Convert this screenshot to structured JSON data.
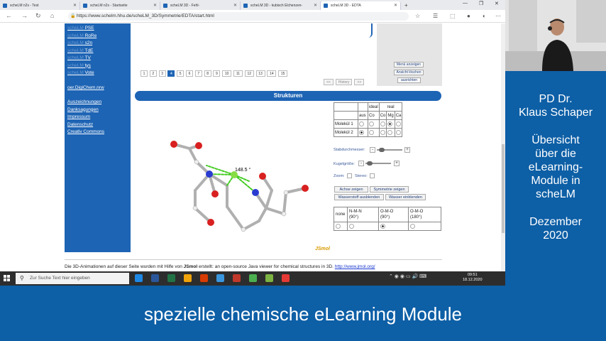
{
  "browser": {
    "tabs": [
      {
        "label": "scheLM n2s - Test",
        "active": false
      },
      {
        "label": "scheLM n2s - Startseite",
        "active": false
      },
      {
        "label": "scheLM 3D - Fehl-",
        "active": false
      },
      {
        "label": "scheLM 3D - kubisch Elchenzen-",
        "active": false
      },
      {
        "label": "scheLM 3D - EDTA",
        "active": true
      }
    ],
    "new_tab": "+",
    "url": "https://www.schelm.hhu.de/scheLM_3D/Symmetrie/EDTA/start.html"
  },
  "sidebar": {
    "links": [
      {
        "prefix": "scheLM",
        "label": "PSE"
      },
      {
        "prefix": "scheLM",
        "label": "RoRe"
      },
      {
        "prefix": "scheLM",
        "label": "s2n"
      },
      {
        "prefix": "scheLM",
        "label": "TdE"
      },
      {
        "prefix": "scheLM",
        "label": "TV"
      },
      {
        "prefix": "scheLM",
        "label": "tys"
      },
      {
        "prefix": "scheLM",
        "label": "Vote"
      }
    ],
    "digichem": "oer.DigiChem.nrw",
    "footer_links": [
      "Auszeichnungen",
      "Danksagungen",
      "Impressum",
      "Datenschutz",
      "Creativ Commons"
    ]
  },
  "pagination": {
    "pages": [
      "1",
      "2",
      "3",
      "4",
      "5",
      "6",
      "7",
      "8",
      "9",
      "10",
      "11",
      "12",
      "13",
      "14",
      "15"
    ],
    "current": "4"
  },
  "right_panel": {
    "menu_btn": "Menü anzeigen",
    "history_btn": "Ansicht löschen",
    "align_btn": "ausrichten",
    "hist_prev": "<<",
    "hist_label": "History",
    "hist_next": ">>"
  },
  "structures": {
    "header": "Strukturen",
    "angle_label": "148.5 °",
    "table": {
      "ideal": "ideal",
      "real": "real",
      "aus": "aus",
      "co": "Co",
      "mg": "Mg",
      "ca": "Ca",
      "mol1": "Molekül 1",
      "mol2": "Molekül 2"
    },
    "stab_label": "Stabdurchmesser:",
    "kugel_label": "Kugelgröße:",
    "zoom_label": "Zoom:",
    "stereo_label": "Stereo:",
    "minus": "-",
    "plus": "+",
    "btn_axes": "Achse zeigen",
    "btn_symmetry": "Symmetrie zeigen",
    "btn_hide_h": "Wasserstoff ausblenden",
    "btn_show_water": "Wasser einblenden",
    "angles": {
      "none": "none",
      "nmn": "N-M-N",
      "nmn_deg": "(90°)",
      "omo": "O-M-O",
      "omo_deg": "(90°)",
      "omo2": "O-M-O",
      "omo2_deg": "(180°)"
    },
    "jsmol": "JSmol"
  },
  "footer": {
    "text_a": "Die 3D-Animationen auf dieser Seite wurden mit Hilfe von ",
    "jsmol_bold": "JSmol",
    "text_b": " erstellt: an open-source Java viewer for chemical structures in 3D. ",
    "link": "http://www.jmol.org/"
  },
  "taskbar": {
    "search_placeholder": "Zur Suche Text hier eingeben",
    "time": "09:51",
    "date": "18.12.2020",
    "app_colors": [
      "#1e88e5",
      "#2b579a",
      "#217346",
      "#f0a30a",
      "#d83b01",
      "#3a96dd",
      "#c0392b",
      "#4caf50",
      "#7cb342",
      "#e53935"
    ]
  },
  "presenter": {
    "name_line1": "PD Dr.",
    "name_line2": "Klaus Schaper",
    "title_lines": [
      "Übersicht",
      "über die",
      "eLearning-",
      "Module in",
      "scheLM"
    ],
    "date_line1": "Dezember",
    "date_line2": "2020"
  },
  "caption": "spezielle chemische eLearning Module",
  "colors": {
    "brand_blue": "#1e64b4",
    "slide_blue": "#0d5fa6",
    "jsmol_orange": "#d89a00"
  }
}
